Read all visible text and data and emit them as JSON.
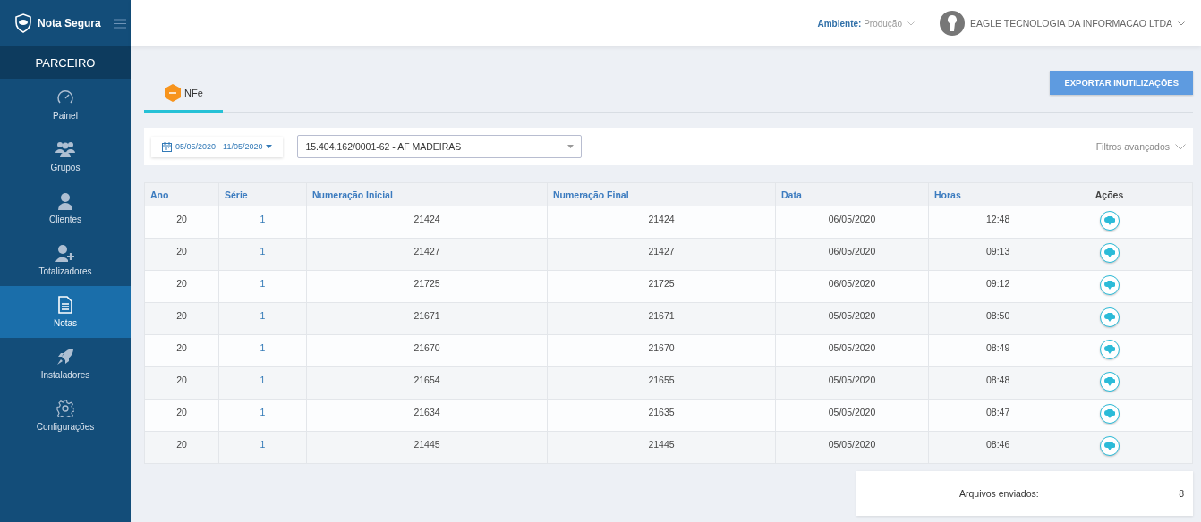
{
  "brand": "Nota Segura",
  "section": "PARCEIRO",
  "sidebar": {
    "items": [
      {
        "label": "Painel",
        "kind": "gauge",
        "selected": false
      },
      {
        "label": "Grupos",
        "kind": "group",
        "selected": false
      },
      {
        "label": "Clientes",
        "kind": "user",
        "selected": false
      },
      {
        "label": "Totalizadores",
        "kind": "adduser",
        "selected": false
      },
      {
        "label": "Notas",
        "kind": "document",
        "selected": true
      },
      {
        "label": "Instaladores",
        "kind": "rocket",
        "selected": false
      },
      {
        "label": "Configurações",
        "kind": "settings",
        "selected": false
      }
    ]
  },
  "header": {
    "env_label": "Ambiente:",
    "env_value": "Produção",
    "company": "EAGLE TECNOLOGIA DA INFORMACAO LTDA"
  },
  "tabs": [
    {
      "label": "NFe",
      "selected": true
    }
  ],
  "export_button": "EXPORTAR INUTILIZAÇÕES",
  "filters": {
    "date_range": "05/05/2020 - 11/05/2020",
    "company_select": "15.404.162/0001-62 - AF MADEIRAS",
    "advanced": "Filtros avançados"
  },
  "table": {
    "columns": [
      "Ano",
      "Série",
      "Numeração Inicial",
      "Numeração Final",
      "Data",
      "Horas",
      "Ações"
    ],
    "rows": [
      [
        "20",
        "1",
        "21424",
        "21424",
        "06/05/2020",
        "12:48"
      ],
      [
        "20",
        "1",
        "21427",
        "21427",
        "06/05/2020",
        "09:13"
      ],
      [
        "20",
        "1",
        "21725",
        "21725",
        "06/05/2020",
        "09:12"
      ],
      [
        "20",
        "1",
        "21671",
        "21671",
        "05/05/2020",
        "08:50"
      ],
      [
        "20",
        "1",
        "21670",
        "21670",
        "05/05/2020",
        "08:49"
      ],
      [
        "20",
        "1",
        "21654",
        "21655",
        "05/05/2020",
        "08:48"
      ],
      [
        "20",
        "1",
        "21634",
        "21635",
        "05/05/2020",
        "08:47"
      ],
      [
        "20",
        "1",
        "21445",
        "21445",
        "05/05/2020",
        "08:46"
      ]
    ]
  },
  "summary": {
    "label": "Arquivos enviados:",
    "value": "8"
  }
}
